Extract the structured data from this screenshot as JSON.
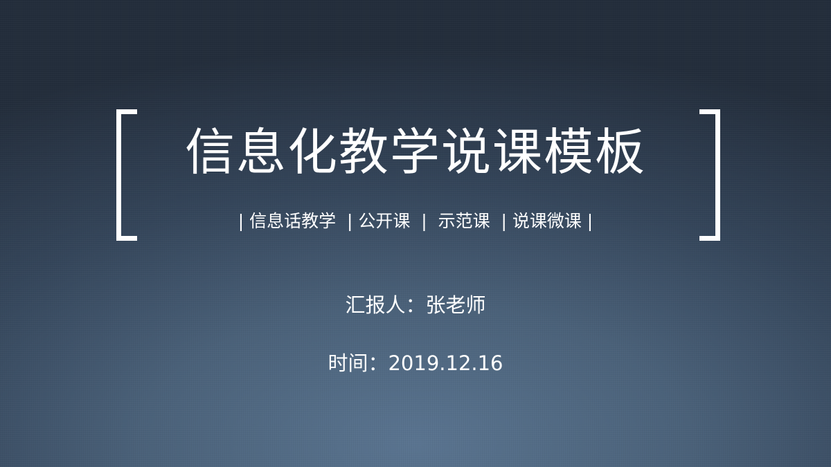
{
  "slide": {
    "title": "信息化教学说课模板",
    "tags": "| 信息话教学  | 公开课  |  示范课  | 说课微课 |",
    "reporter": "汇报人：张老师",
    "date": "时间：2019.12.16"
  },
  "colors": {
    "text": "#ffffff",
    "background_top": "#232d3b",
    "background_bottom": "#5a7490"
  }
}
